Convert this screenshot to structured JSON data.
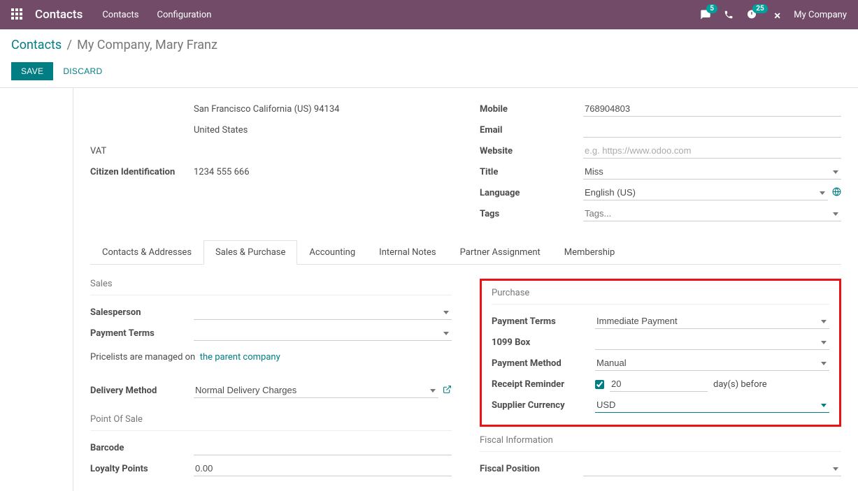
{
  "nav": {
    "brand": "Contacts",
    "links": [
      "Contacts",
      "Configuration"
    ],
    "chat_badge": "5",
    "activity_badge": "25",
    "company": "My Company"
  },
  "breadcrumb": {
    "root": "Contacts",
    "sep": "/",
    "leaf": "My Company, Mary Franz"
  },
  "actions": {
    "save": "SAVE",
    "discard": "DISCARD"
  },
  "form": {
    "address": {
      "line1": "San Francisco  California (US)  94134",
      "line2": "United States"
    },
    "vat_label": "VAT",
    "citizen_id_label": "Citizen Identification",
    "citizen_id_value": "1234 555 666",
    "mobile_label": "Mobile",
    "mobile_value": "768904803",
    "email_label": "Email",
    "email_value": "",
    "website_label": "Website",
    "website_placeholder": "e.g. https://www.odoo.com",
    "title_label": "Title",
    "title_value": "Miss",
    "language_label": "Language",
    "language_value": "English (US)",
    "tags_label": "Tags",
    "tags_placeholder": "Tags..."
  },
  "tabs": {
    "items": [
      "Contacts & Addresses",
      "Sales & Purchase",
      "Accounting",
      "Internal Notes",
      "Partner Assignment",
      "Membership"
    ],
    "active_index": 1
  },
  "sales": {
    "section": "Sales",
    "salesperson_label": "Salesperson",
    "payment_terms_label": "Payment Terms",
    "pricelists_note_prefix": "Pricelists are managed on",
    "pricelists_link": "the parent company",
    "delivery_method_label": "Delivery Method",
    "delivery_method_value": "Normal Delivery Charges"
  },
  "purchase": {
    "section": "Purchase",
    "payment_terms_label": "Payment Terms",
    "payment_terms_value": "Immediate Payment",
    "box1099_label": "1099 Box",
    "payment_method_label": "Payment Method",
    "payment_method_value": "Manual",
    "receipt_reminder_label": "Receipt Reminder",
    "receipt_reminder_checked": true,
    "receipt_reminder_days": "20",
    "receipt_reminder_suffix": "day(s) before",
    "supplier_currency_label": "Supplier Currency",
    "supplier_currency_value": "USD"
  },
  "pos": {
    "section": "Point Of Sale",
    "barcode_label": "Barcode",
    "loyalty_label": "Loyalty Points",
    "loyalty_value": "0.00"
  },
  "fiscal": {
    "section": "Fiscal Information",
    "position_label": "Fiscal Position"
  }
}
